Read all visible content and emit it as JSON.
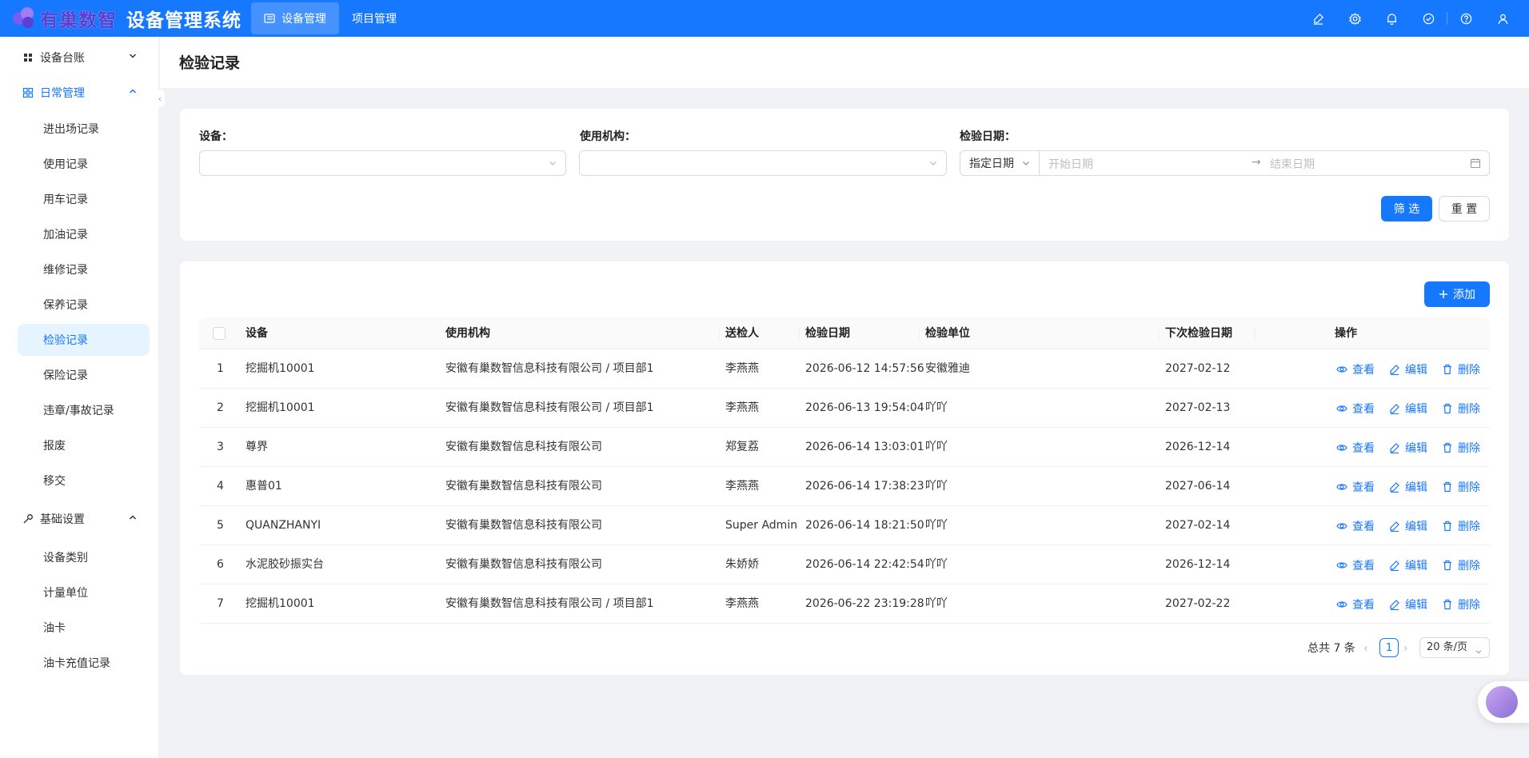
{
  "header": {
    "logo_text": "有巢数智",
    "system_title": "设备管理系统",
    "nav": [
      {
        "label": "设备管理",
        "active": true
      },
      {
        "label": "项目管理",
        "active": false
      }
    ],
    "actions": [
      "brush-icon",
      "gear-icon",
      "bell-icon",
      "check-circle-icon",
      "help-icon",
      "user-icon"
    ]
  },
  "sidebar": {
    "groups": [
      {
        "label": "设备台账",
        "icon": "puzzle-icon",
        "open": false
      },
      {
        "label": "日常管理",
        "icon": "layout-icon",
        "open": true
      },
      {
        "label": "基础设置",
        "icon": "tool-icon",
        "open": true
      }
    ],
    "daily_items": [
      "进出场记录",
      "使用记录",
      "用车记录",
      "加油记录",
      "维修记录",
      "保养记录",
      "检验记录",
      "保险记录",
      "违章/事故记录",
      "报废",
      "移交"
    ],
    "settings_items": [
      "设备类别",
      "计量单位",
      "油卡",
      "油卡充值记录"
    ],
    "selected": "检验记录"
  },
  "page": {
    "title": "检验记录"
  },
  "filters": {
    "device_label": "设备：",
    "org_label": "使用机构：",
    "date_label": "检验日期：",
    "date_mode": "指定日期",
    "start_placeholder": "开始日期",
    "end_placeholder": "结束日期",
    "filter_button": "筛 选",
    "reset_button": "重 置"
  },
  "table": {
    "add_button": "添加",
    "columns": [
      "设备",
      "使用机构",
      "送检人",
      "检验日期",
      "检验单位",
      "下次检验日期",
      "操作"
    ],
    "actions": [
      "查看",
      "编辑",
      "删除"
    ],
    "rows": [
      {
        "no": "1",
        "device": "挖掘机10001",
        "org": "安徽有巢数智信息科技有限公司 / 项目部1",
        "person": "李燕燕",
        "date": "2026-06-12 14:57:56",
        "unit": "安徽雅迪",
        "next": "2027-02-12"
      },
      {
        "no": "2",
        "device": "挖掘机10001",
        "org": "安徽有巢数智信息科技有限公司 / 项目部1",
        "person": "李燕燕",
        "date": "2026-06-13 19:54:04",
        "unit": "吖吖",
        "next": "2027-02-13"
      },
      {
        "no": "3",
        "device": "尊界",
        "org": "安徽有巢数智信息科技有限公司",
        "person": "郑复荔",
        "date": "2026-06-14 13:03:01",
        "unit": "吖吖",
        "next": "2026-12-14"
      },
      {
        "no": "4",
        "device": "惠普01",
        "org": "安徽有巢数智信息科技有限公司",
        "person": "李燕燕",
        "date": "2026-06-14 17:38:23",
        "unit": "吖吖",
        "next": "2027-06-14"
      },
      {
        "no": "5",
        "device": "QUANZHANYI",
        "org": "安徽有巢数智信息科技有限公司",
        "person": "Super Admin",
        "date": "2026-06-14 18:21:50",
        "unit": "吖吖",
        "next": "2027-02-14"
      },
      {
        "no": "6",
        "device": "水泥胶砂振实台",
        "org": "安徽有巢数智信息科技有限公司",
        "person": "朱娇娇",
        "date": "2026-06-14 22:42:54",
        "unit": "吖吖",
        "next": "2026-12-14"
      },
      {
        "no": "7",
        "device": "挖掘机10001",
        "org": "安徽有巢数智信息科技有限公司 / 项目部1",
        "person": "李燕燕",
        "date": "2026-06-22 23:19:28",
        "unit": "吖吖",
        "next": "2027-02-22"
      }
    ]
  },
  "pagination": {
    "total": "总共 7 条",
    "current_page": "1",
    "page_size": "20 条/页"
  },
  "colors": {
    "primary": "#1677ff",
    "logo": "#5b3ccf"
  }
}
